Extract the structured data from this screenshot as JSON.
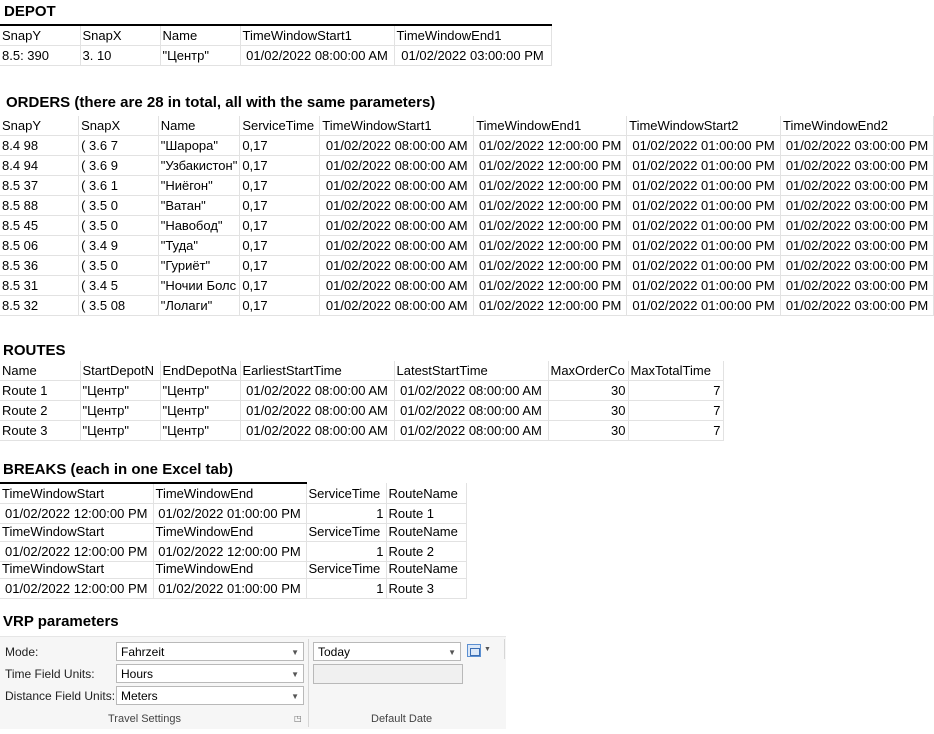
{
  "depot": {
    "title": "DEPOT",
    "headers": [
      "SnapY",
      "SnapX",
      "Name",
      "TimeWindowStart1",
      "TimeWindowEnd1"
    ],
    "rows": [
      [
        "8.5:  390",
        "3.  10",
        "\"Центр\"",
        "01/02/2022 08:00:00 AM",
        "01/02/2022 03:00:00 PM"
      ]
    ]
  },
  "orders": {
    "title": "ORDERS (there are 28 in total, all with the same parameters)",
    "headers": [
      "SnapY",
      "SnapX",
      "Name",
      "ServiceTime",
      "TimeWindowStart1",
      "TimeWindowEnd1",
      "TimeWindowStart2",
      "TimeWindowEnd2"
    ],
    "rows": [
      [
        "8.4  98",
        "( 3.6  7",
        "\"Шарора\"",
        "0,17",
        "01/02/2022 08:00:00 AM",
        "01/02/2022 12:00:00 PM",
        "01/02/2022 01:00:00 PM",
        "01/02/2022 03:00:00 PM"
      ],
      [
        "8.4  94",
        "( 3.6  9",
        "\"Узбакистон\"",
        "0,17",
        "01/02/2022 08:00:00 AM",
        "01/02/2022 12:00:00 PM",
        "01/02/2022 01:00:00 PM",
        "01/02/2022 03:00:00 PM"
      ],
      [
        "8.5  37",
        "( 3.6  1",
        "\"Ниёгон\"",
        "0,17",
        "01/02/2022 08:00:00 AM",
        "01/02/2022 12:00:00 PM",
        "01/02/2022 01:00:00 PM",
        "01/02/2022 03:00:00 PM"
      ],
      [
        "8.5  88",
        "( 3.5  0",
        "\"Ватан\"",
        "0,17",
        "01/02/2022 08:00:00 AM",
        "01/02/2022 12:00:00 PM",
        "01/02/2022 01:00:00 PM",
        "01/02/2022 03:00:00 PM"
      ],
      [
        "8.5  45",
        "( 3.5  0",
        "\"Навобод\"",
        "0,17",
        "01/02/2022 08:00:00 AM",
        "01/02/2022 12:00:00 PM",
        "01/02/2022 01:00:00 PM",
        "01/02/2022 03:00:00 PM"
      ],
      [
        "8.5  06",
        "( 3.4  9",
        "\"Туда\"",
        "0,17",
        "01/02/2022 08:00:00 AM",
        "01/02/2022 12:00:00 PM",
        "01/02/2022 01:00:00 PM",
        "01/02/2022 03:00:00 PM"
      ],
      [
        "8.5  36",
        "( 3.5  0",
        "\"Гуриёт\"",
        "0,17",
        "01/02/2022 08:00:00 AM",
        "01/02/2022 12:00:00 PM",
        "01/02/2022 01:00:00 PM",
        "01/02/2022 03:00:00 PM"
      ],
      [
        "8.5  31",
        "( 3.4  5",
        "\"Ночии Болс",
        "0,17",
        "01/02/2022 08:00:00 AM",
        "01/02/2022 12:00:00 PM",
        "01/02/2022 01:00:00 PM",
        "01/02/2022 03:00:00 PM"
      ],
      [
        "8.5  32",
        "( 3.5  08",
        "\"Лолаги\"",
        "0,17",
        "01/02/2022 08:00:00 AM",
        "01/02/2022 12:00:00 PM",
        "01/02/2022 01:00:00 PM",
        "01/02/2022 03:00:00 PM"
      ]
    ]
  },
  "routes": {
    "title": "ROUTES",
    "headers": [
      "Name",
      "StartDepotN",
      "EndDepotNa",
      "EarliestStartTime",
      "LatestStartTime",
      "MaxOrderCo",
      "MaxTotalTime"
    ],
    "rows": [
      [
        "Route 1",
        "\"Центр\"",
        "\"Центр\"",
        "01/02/2022 08:00:00 AM",
        "01/02/2022 08:00:00 AM",
        "30",
        "7"
      ],
      [
        "Route 2",
        "\"Центр\"",
        "\"Центр\"",
        "01/02/2022 08:00:00 AM",
        "01/02/2022 08:00:00 AM",
        "30",
        "7"
      ],
      [
        "Route 3",
        "\"Центр\"",
        "\"Центр\"",
        "01/02/2022 08:00:00 AM",
        "01/02/2022 08:00:00 AM",
        "30",
        "7"
      ]
    ]
  },
  "breaks": {
    "title": "BREAKS (each in one Excel tab)",
    "blocks": [
      {
        "headers": [
          "TimeWindowStart",
          "TimeWindowEnd",
          "ServiceTime",
          "RouteName"
        ],
        "row": [
          "01/02/2022 12:00:00 PM",
          "01/02/2022 01:00:00 PM",
          "1",
          "Route 1"
        ]
      },
      {
        "headers": [
          "TimeWindowStart",
          "TimeWindowEnd",
          "ServiceTime",
          "RouteName"
        ],
        "row": [
          "01/02/2022 12:00:00 PM",
          "01/02/2022 12:00:00 PM",
          "1",
          "Route 2"
        ]
      },
      {
        "headers": [
          "TimeWindowStart",
          "TimeWindowEnd",
          "ServiceTime",
          "RouteName"
        ],
        "row": [
          "01/02/2022 12:00:00 PM",
          "01/02/2022 01:00:00 PM",
          "1",
          "Route 3"
        ]
      }
    ]
  },
  "vrp": {
    "title": "VRP parameters",
    "mode_label": "Mode:",
    "mode_value": "Fahrzeit",
    "time_units_label": "Time Field Units:",
    "time_units_value": "Hours",
    "distance_units_label": "Distance Field Units:",
    "distance_units_value": "Meters",
    "date_value": "Today",
    "travel_caption": "Travel Settings",
    "date_caption": "Default Date",
    "calendar_icon": "calendar-icon",
    "launcher_icon": "dialog-launcher-icon"
  }
}
